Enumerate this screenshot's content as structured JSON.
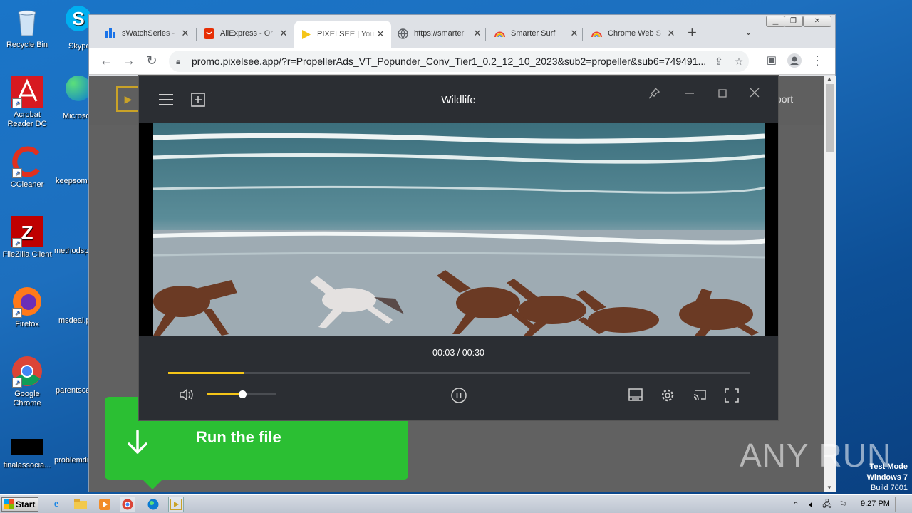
{
  "desktop": {
    "icons": [
      {
        "label": "Recycle Bin",
        "icon": "recycle-bin-icon"
      },
      {
        "label": "Acrobat Reader DC",
        "icon": "acrobat-icon"
      },
      {
        "label": "CCleaner",
        "icon": "ccleaner-icon"
      },
      {
        "label": "FileZilla Client",
        "icon": "filezilla-icon"
      },
      {
        "label": "Firefox",
        "icon": "firefox-icon"
      },
      {
        "label": "Google Chrome",
        "icon": "chrome-icon"
      },
      {
        "label": "finalassocia...",
        "icon": "file-icon"
      }
    ],
    "icons_col2": [
      {
        "label": "Skype",
        "icon": "skype-icon"
      },
      {
        "label": "Microsoft",
        "icon": "edge-icon"
      },
      {
        "label": "keepsome",
        "icon": "file-icon"
      },
      {
        "label": "methodsp",
        "icon": "file-icon"
      },
      {
        "label": "msdeal.p",
        "icon": "file-icon"
      },
      {
        "label": "parentsca",
        "icon": "file-icon"
      },
      {
        "label": "problemdi",
        "icon": "file-icon"
      }
    ]
  },
  "browser": {
    "tabs": [
      {
        "title": "sWatchSeries -",
        "icon": "watchseries-icon"
      },
      {
        "title": "AliExpress - Or",
        "icon": "aliexpress-icon"
      },
      {
        "title": "PIXELSEE | You",
        "icon": "pixelsee-icon",
        "active": true
      },
      {
        "title": "https://smarter",
        "icon": "globe-icon"
      },
      {
        "title": "Smarter Surf",
        "icon": "rainbow-icon"
      },
      {
        "title": "Chrome Web S",
        "icon": "rainbow-icon"
      }
    ],
    "new_tab": "+",
    "url": "promo.pixelsee.app/?r=PropellerAds_VT_Popunder_Conv_Tier1_0.2_12_10_2023&sub2=propeller&sub6=749491..."
  },
  "site": {
    "nav_text": "port"
  },
  "player": {
    "title": "Wildlife",
    "time": "00:03 / 00:30",
    "progress": 0.13,
    "volume": 0.5
  },
  "run_file": {
    "label": "Run the file"
  },
  "watermark": {
    "brand": "ANY RUN",
    "test_mode": "Test Mode",
    "os": "Windows 7",
    "build": "Build 7601"
  },
  "taskbar": {
    "start": "Start",
    "clock": "9:27 PM"
  },
  "colors": {
    "accent": "#f5c518",
    "run_green": "#2bbf33"
  }
}
